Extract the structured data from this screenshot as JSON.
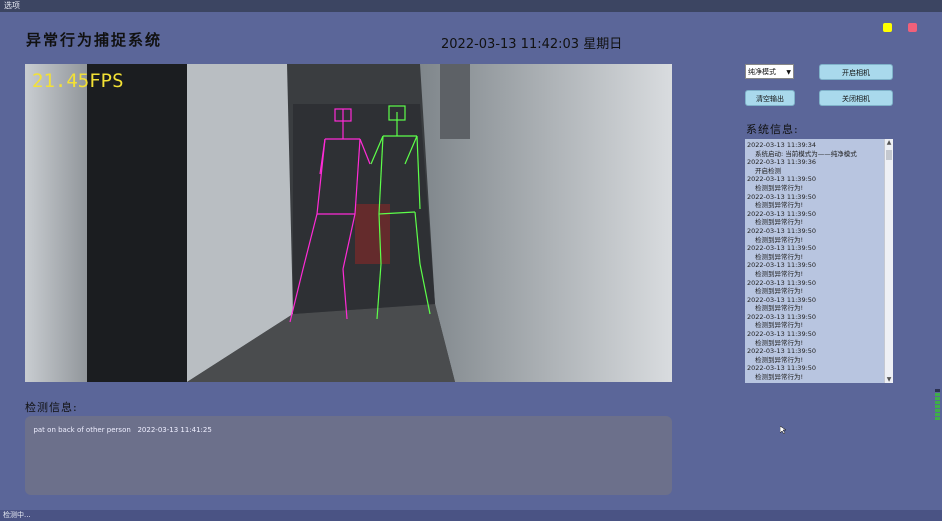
{
  "menubar": {
    "label": "选项"
  },
  "header": {
    "title": "异常行为捕捉系统",
    "datetime": "2022-03-13 11:42:03 星期日",
    "accent_yellow": "#ffff00",
    "accent_red": "#f0607a"
  },
  "video": {
    "fps": "21.45FPS",
    "fps_color": "#f3e135",
    "skeleton_colors": [
      "#ff2bd6",
      "#5dff4a"
    ]
  },
  "controls": {
    "mode_select": {
      "value": "纯净模式"
    },
    "open_camera": "开启相机",
    "clear_output": "清空输出",
    "close_camera": "关闭相机"
  },
  "system_info": {
    "label": "系统信息:",
    "log": [
      {
        "time": "2022-03-13 11:39:34",
        "msg": "系统启动: 当前模式为——纯净模式"
      },
      {
        "time": "2022-03-13 11:39:36",
        "msg": "开启检测"
      },
      {
        "time": "2022-03-13 11:39:50",
        "msg": "检测到异常行为!"
      },
      {
        "time": "2022-03-13 11:39:50",
        "msg": "检测到异常行为!"
      },
      {
        "time": "2022-03-13 11:39:50",
        "msg": "检测到异常行为!"
      },
      {
        "time": "2022-03-13 11:39:50",
        "msg": "检测到异常行为!"
      },
      {
        "time": "2022-03-13 11:39:50",
        "msg": "检测到异常行为!"
      },
      {
        "time": "2022-03-13 11:39:50",
        "msg": "检测到异常行为!"
      },
      {
        "time": "2022-03-13 11:39:50",
        "msg": "检测到异常行为!"
      },
      {
        "time": "2022-03-13 11:39:50",
        "msg": "检测到异常行为!"
      },
      {
        "time": "2022-03-13 11:39:50",
        "msg": "检测到异常行为!"
      },
      {
        "time": "2022-03-13 11:39:50",
        "msg": "检测到异常行为!"
      },
      {
        "time": "2022-03-13 11:39:50",
        "msg": "检测到异常行为!"
      },
      {
        "time": "2022-03-13 11:39:50",
        "msg": "检测到异常行为!"
      }
    ]
  },
  "detection_info": {
    "label": "检测信息:",
    "entry": "pat on back of other person   2022-03-13 11:41:25"
  },
  "statusbar": {
    "text": "检测中..."
  }
}
